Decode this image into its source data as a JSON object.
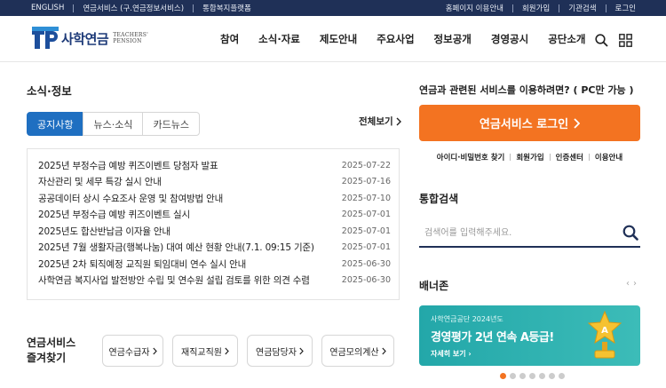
{
  "topbar": {
    "left_links": [
      "ENGLISH",
      "연금서비스 (구.연금정보서비스)",
      "통합복지플랫폼"
    ],
    "right_links": [
      "홈페이지 이용안내",
      "회원가입",
      "기관검색",
      "로그인"
    ]
  },
  "header": {
    "logo_text": "사학연금",
    "logo_en_line1": "TEACHERS'",
    "logo_en_line2": "PENSION",
    "nav": [
      "참여",
      "소식·자료",
      "제도안내",
      "주요사업",
      "정보공개",
      "경영공시",
      "공단소개"
    ],
    "search_icon": "search-icon",
    "menu_icon": "grid-menu-icon"
  },
  "news": {
    "title": "소식·정보",
    "tabs": [
      "공지사항",
      "뉴스·소식",
      "카드뉴스"
    ],
    "active_tab": "공지사항",
    "more_label": "전체보기",
    "items": [
      {
        "title": "2025년 부정수급 예방 퀴즈이벤트 당첨자 발표",
        "date": "2025-07-22"
      },
      {
        "title": "자산관리 및 세무 특강 실시 안내",
        "date": "2025-07-16"
      },
      {
        "title": "공공데이터 상시 수요조사 운영 및 참여방법 안내",
        "date": "2025-07-10"
      },
      {
        "title": "2025년 부정수급 예방 퀴즈이벤트 실시",
        "date": "2025-07-01"
      },
      {
        "title": "2025년도 합산반납금 이자율 안내",
        "date": "2025-07-01"
      },
      {
        "title": "2025년 7월 생활자금(행복나눔) 대여 예산 현황 안내(7.1. 09:15 기준)",
        "date": "2025-07-01"
      },
      {
        "title": "2025년 2차 퇴직예정 교직원 퇴임대비 연수 실시 안내",
        "date": "2025-06-30"
      },
      {
        "title": "사학연금 복지사업 발전방안 수립 및 연수원 설립 검토를 위한 의견 수렴",
        "date": "2025-06-30"
      }
    ]
  },
  "favorites": {
    "title_line1": "연금서비스",
    "title_line2": "즐겨찾기",
    "buttons": [
      "연금수급자",
      "재직교직원",
      "연금담당자",
      "연금모의계산"
    ]
  },
  "login": {
    "question": "연금과 관련된 서비스를 이용하려면? ( PC만 가능 )",
    "button_label": "연금서비스 로그인",
    "links": [
      "아이디·비밀번호 찾기",
      "회원가입",
      "인증센터",
      "이용안내"
    ]
  },
  "search": {
    "title": "통합검색",
    "placeholder": "검색어를 입력해주세요."
  },
  "banner": {
    "title": "배너존",
    "prev": "‹",
    "next": "›",
    "subtitle": "사학연금공단 2024년도",
    "headline": "경영평가 2년 연속 A등급!",
    "link_label": "자세히 보기",
    "badge_letter": "A",
    "slide_count": 7,
    "active_slide": 1
  },
  "colors": {
    "topbar": "#1f3057",
    "accent_blue": "#1f6fc1",
    "accent_orange": "#f37321",
    "banner_teal": "#2fb1b0"
  }
}
